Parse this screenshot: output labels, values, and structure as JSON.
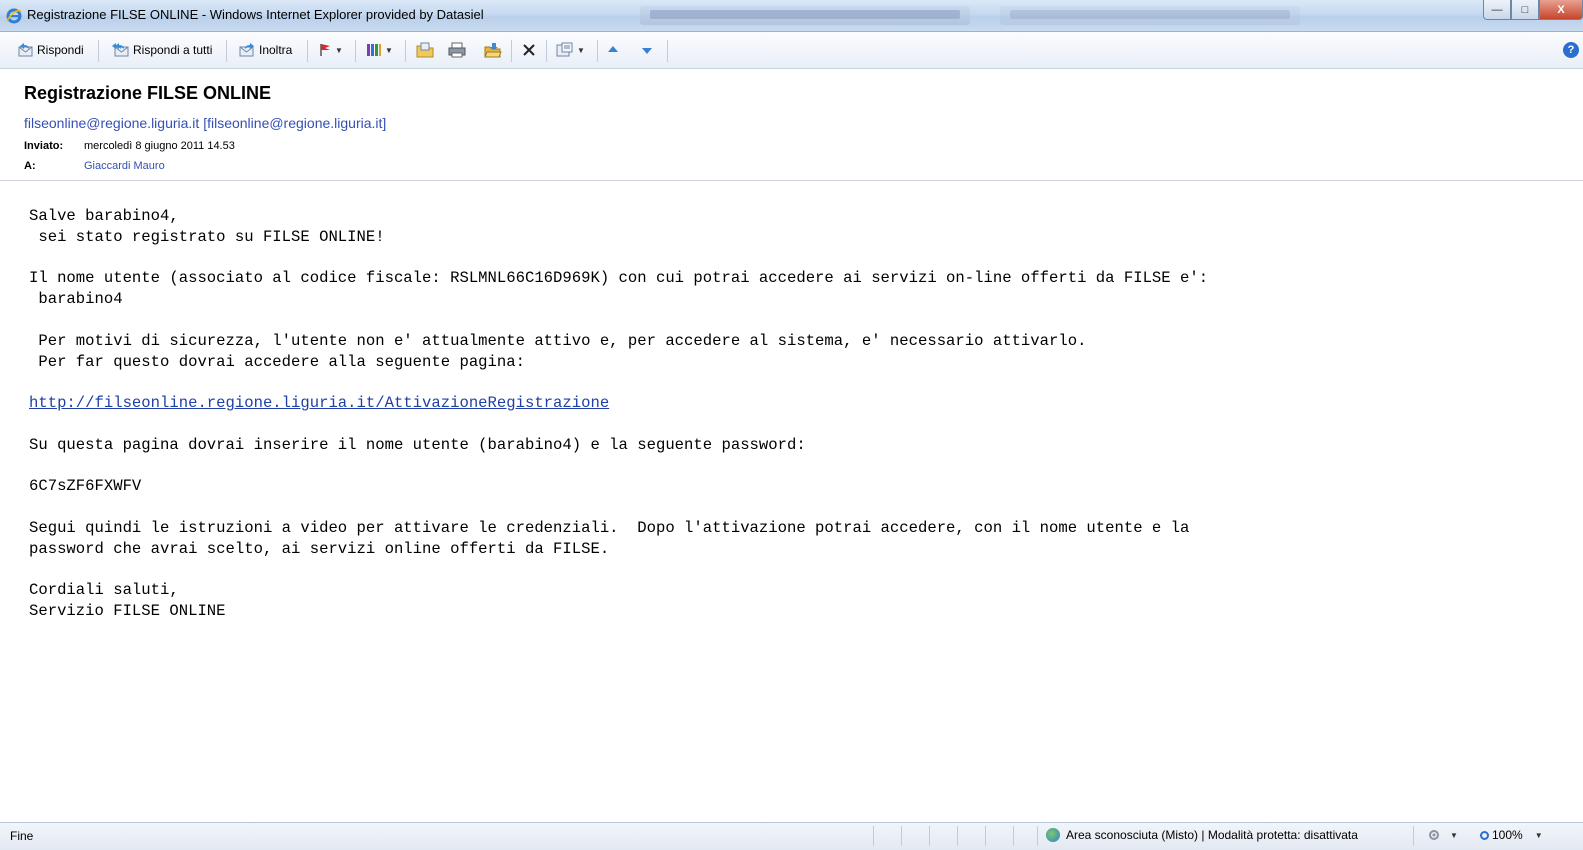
{
  "window": {
    "title": "Registrazione FILSE ONLINE - Windows Internet Explorer provided by Datasiel",
    "minimize_icon": "minimize-icon",
    "maximize_icon": "maximize-icon",
    "close_icon": "close-icon"
  },
  "toolbar": {
    "reply_label": "Rispondi",
    "reply_all_label": "Rispondi a tutti",
    "forward_label": "Inoltra",
    "icons": [
      "flag-icon",
      "categorize-icon",
      "move-to-folder-icon",
      "print-icon",
      "open-folder-icon",
      "delete-icon",
      "actions-icon",
      "previous-item-icon",
      "next-item-icon",
      "help-icon"
    ]
  },
  "message": {
    "subject": "Registrazione FILSE ONLINE",
    "from": "filseonline@regione.liguria.it [filseonline@regione.liguria.it]",
    "sent_label": "Inviato:",
    "sent_value": "mercoledì 8 giugno 2011 14.53",
    "to_label": "A:",
    "to_value": "Giaccardi Mauro",
    "body": {
      "greeting_line1": "Salve barabino4,",
      "greeting_line2": " sei stato registrato su FILSE ONLINE!",
      "username_line1": "Il nome utente (associato al codice fiscale: RSLMNL66C16D969K) con cui potrai accedere ai servizi on-line offerti da FILSE e':",
      "username_line2": " barabino4",
      "security_line1": " Per motivi di sicurezza, l'utente non e' attualmente attivo e, per accedere al sistema, e' necessario attivarlo.",
      "security_line2": " Per far questo dovrai accedere alla seguente pagina:",
      "activation_link": "http://filseonline.regione.liguria.it/AttivazioneRegistrazione",
      "password_intro": "Su questa pagina dovrai inserire il nome utente (barabino4) e la seguente password:",
      "password": "6C7sZF6FXWFV",
      "instructions_line1": "Segui quindi le istruzioni a video per attivare le credenziali.  Dopo l'attivazione potrai accedere, con il nome utente e la",
      "instructions_line2": "password che avrai scelto, ai servizi online offerti da FILSE.",
      "closing_line1": "Cordiali saluti,",
      "closing_line2": "Servizio FILSE ONLINE"
    }
  },
  "statusbar": {
    "status": "Fine",
    "zone": "Area sconosciuta (Misto) | Modalità protetta: disattivata",
    "zoom": "100%"
  },
  "colors": {
    "link": "#1f3fa6",
    "sender": "#3450b4",
    "titlebar": "#c6d9f1"
  }
}
